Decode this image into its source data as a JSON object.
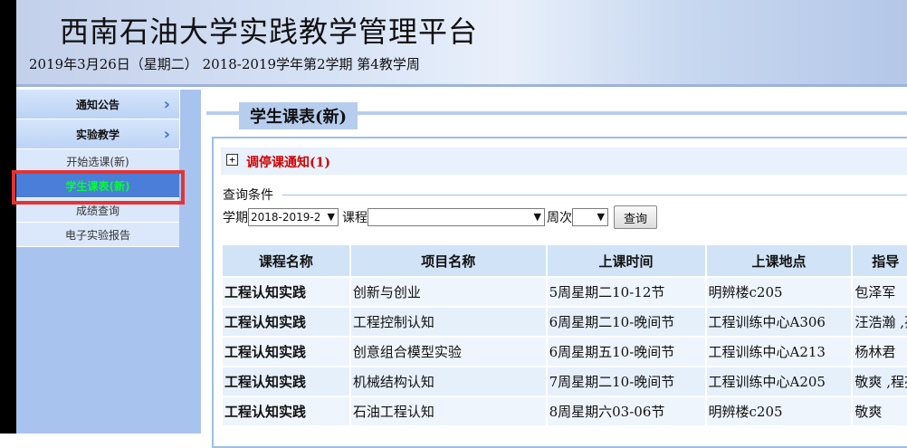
{
  "header": {
    "title": "西南石油大学实践教学管理平台",
    "date_line": "2019年3月26日（星期二） 2018-2019学年第2学期 第4教学周"
  },
  "sidebar": {
    "groups": [
      {
        "label": "通知公告",
        "chevron": "›"
      },
      {
        "label": "实验教学",
        "chevron": "›"
      }
    ],
    "items": [
      {
        "label": "开始选课(新)"
      },
      {
        "label": "学生课表(新)"
      },
      {
        "label": "成绩查询"
      },
      {
        "label": "电子实验报告"
      }
    ]
  },
  "main": {
    "page_title": "学生课表(新)",
    "notice": {
      "icon": "plus-box-icon",
      "text": "调停课通知(1)"
    },
    "query": {
      "legend": "查询条件",
      "term_label": "学期",
      "term_value": "2018-2019-2",
      "course_label": "课程",
      "course_value": "",
      "week_label": "周次",
      "week_value": "",
      "submit": "查询"
    },
    "table": {
      "headers": [
        "课程名称",
        "项目名称",
        "上课时间",
        "上课地点",
        "指导"
      ],
      "rows": [
        [
          "工程认知实践",
          "创新与创业",
          "5周星期二10-12节",
          "明辨楼c205",
          "包泽军"
        ],
        [
          "工程认知实践",
          "工程控制认知",
          "6周星期二10-晚间节",
          "工程训练中心A306",
          "汪浩瀚 ,孙"
        ],
        [
          "工程认知实践",
          "创意组合模型实验",
          "6周星期五10-晚间节",
          "工程训练中心A213",
          "杨林君"
        ],
        [
          "工程认知实践",
          "机械结构认知",
          "7周星期二10-晚间节",
          "工程训练中心A205",
          "敬爽 ,程亮"
        ],
        [
          "工程认知实践",
          "石油工程认知",
          "8周星期六03-06节",
          "明辨楼c205",
          "敬爽"
        ]
      ]
    }
  },
  "colors": {
    "accent": "#4a7ed8",
    "highlight": "#e53333",
    "notice": "#d10000"
  }
}
